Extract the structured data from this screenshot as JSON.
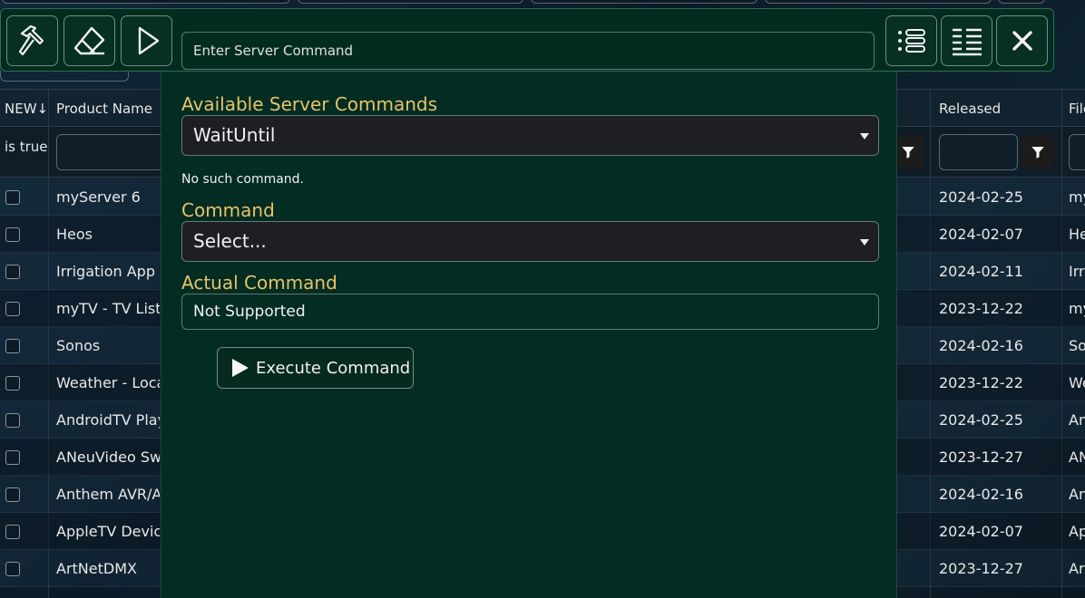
{
  "grid": {
    "headers": {
      "new": "NEW",
      "new_sort": "↓",
      "product_name": "Product Name",
      "released": "Released",
      "file": "File"
    },
    "filters": {
      "new_value": "is true"
    },
    "rows": [
      {
        "name": "myServer 6",
        "released": "2024-02-25",
        "file": "myServer"
      },
      {
        "name": "Heos",
        "released": "2024-02-07",
        "file": "Heos"
      },
      {
        "name": "Irrigation App",
        "released": "2024-02-11",
        "file": "Irrigation"
      },
      {
        "name": "myTV - TV Listings",
        "released": "2023-12-22",
        "file": "myTV"
      },
      {
        "name": "Sonos",
        "released": "2024-02-16",
        "file": "Sonos"
      },
      {
        "name": "Weather - Local",
        "released": "2023-12-22",
        "file": "Weather"
      },
      {
        "name": "AndroidTV Player",
        "released": "2024-02-25",
        "file": "AndroidTV"
      },
      {
        "name": "ANeuVideo Switch",
        "released": "2023-12-27",
        "file": "ANeu"
      },
      {
        "name": "Anthem AVR/AV",
        "released": "2024-02-16",
        "file": "Anthem"
      },
      {
        "name": "AppleTV Device",
        "released": "2024-02-07",
        "file": "AppleTV"
      },
      {
        "name": "ArtNetDMX",
        "released": "2023-12-27",
        "file": "ArtNet"
      }
    ]
  },
  "toolbar": {
    "build_icon": "hammer-icon",
    "clear_icon": "eraser-icon",
    "run_icon": "play-icon",
    "command_placeholder": "Enter Server Command",
    "list_icon": "list-icon",
    "details_icon": "details-list-icon",
    "close_icon": "close-icon"
  },
  "dialog": {
    "available_label": "Available Server Commands",
    "available_value": "WaitUntil",
    "note": "No such command.",
    "command_label": "Command",
    "command_value": "Select...",
    "actual_label": "Actual Command",
    "actual_value": "Not Supported",
    "execute_label": "Execute Command"
  },
  "colors": {
    "accent_label": "#e7c36b",
    "panel_bg": "#032c22",
    "page_bg": "#0c1a26"
  }
}
